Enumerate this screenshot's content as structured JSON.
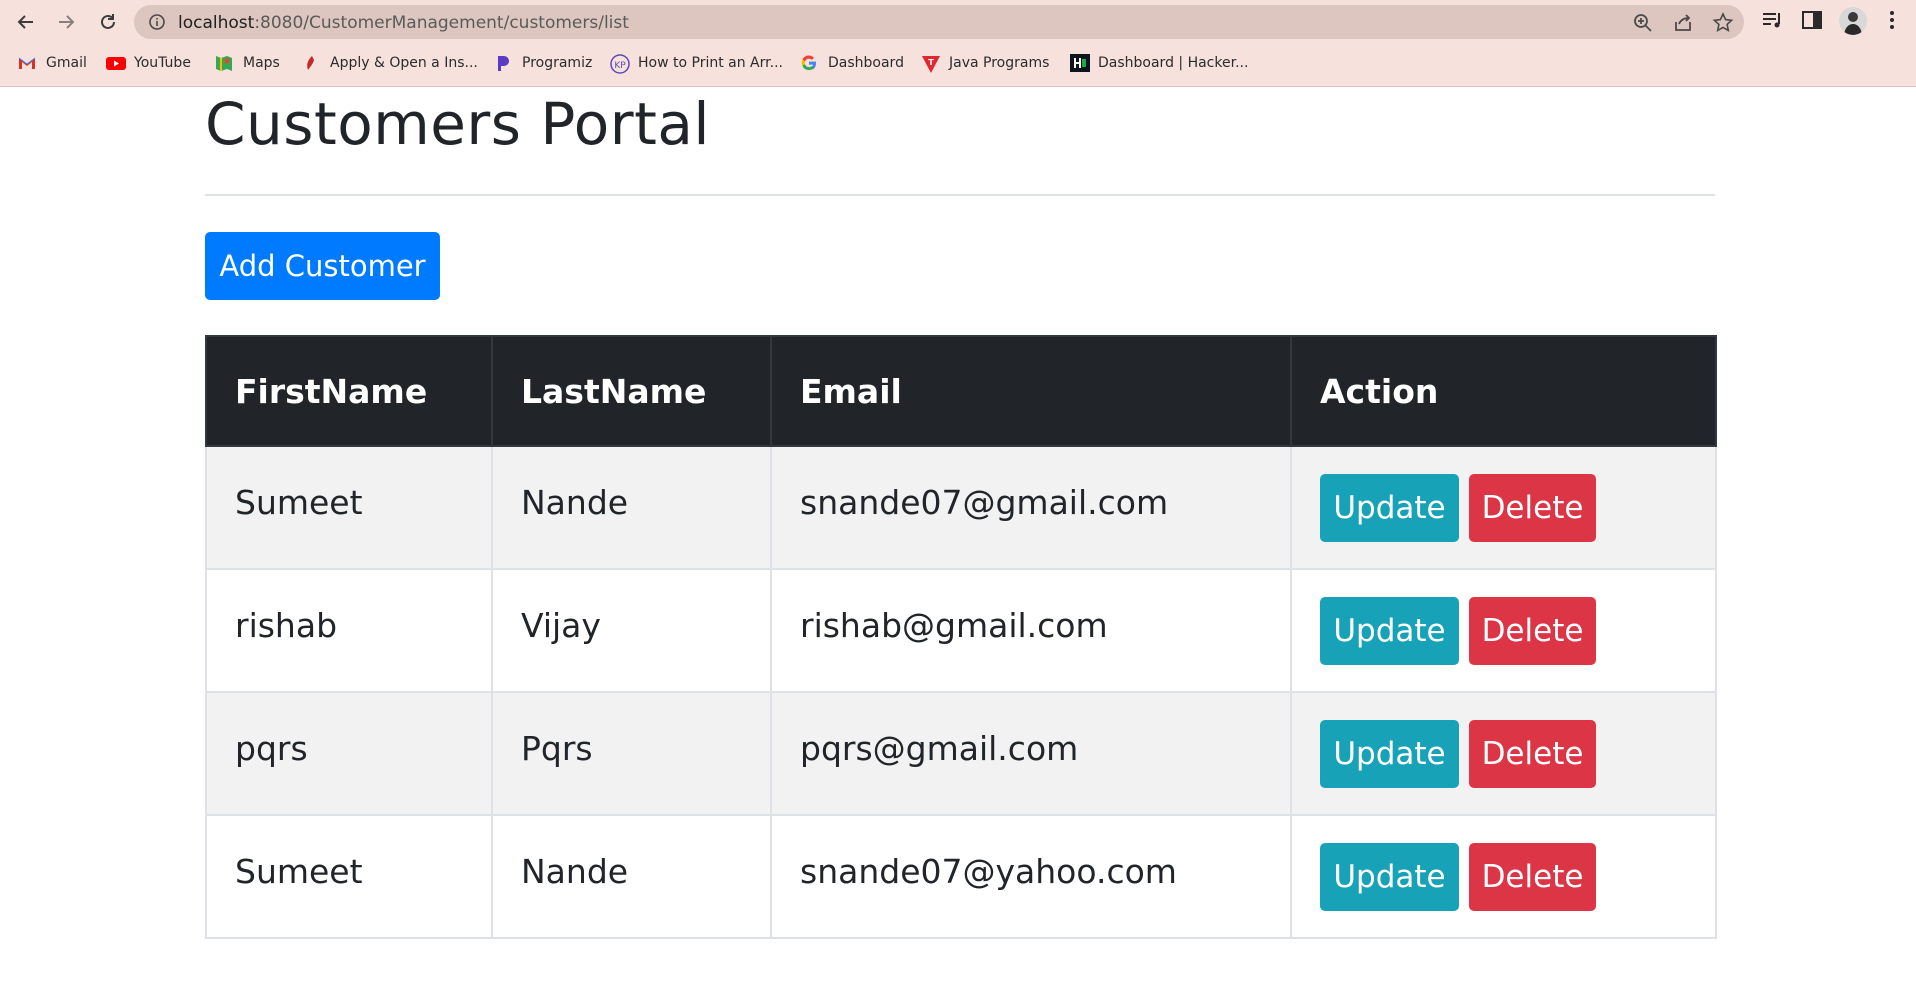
{
  "browser": {
    "url_host": "localhost",
    "url_rest": ":8080/CustomerManagement/customers/list",
    "bookmarks": [
      {
        "label": "Gmail",
        "icon": "gmail-icon"
      },
      {
        "label": "YouTube",
        "icon": "youtube-icon"
      },
      {
        "label": "Maps",
        "icon": "maps-icon"
      },
      {
        "label": "Apply & Open a Ins...",
        "icon": "apply-icon"
      },
      {
        "label": "Programiz",
        "icon": "programiz-icon"
      },
      {
        "label": "How to Print an Arr...",
        "icon": "kp-icon"
      },
      {
        "label": "Dashboard",
        "icon": "google-icon"
      },
      {
        "label": "Java Programs",
        "icon": "java-icon"
      },
      {
        "label": "Dashboard | Hacker...",
        "icon": "hackerrank-icon"
      }
    ]
  },
  "page": {
    "title": "Customers Portal",
    "add_button": "Add Customer"
  },
  "table": {
    "headers": [
      "FirstName",
      "LastName",
      "Email",
      "Action"
    ],
    "rows": [
      {
        "first": "Sumeet",
        "last": "Nande",
        "email": "snande07@gmail.com"
      },
      {
        "first": "rishab",
        "last": "Vijay",
        "email": "rishab@gmail.com"
      },
      {
        "first": "pqrs",
        "last": "Pqrs",
        "email": "pqrs@gmail.com"
      },
      {
        "first": "Sumeet",
        "last": "Nande",
        "email": "snande07@yahoo.com"
      }
    ],
    "update_label": "Update",
    "delete_label": "Delete"
  },
  "colors": {
    "primary": "#007bff",
    "info": "#17a2b8",
    "danger": "#dc3545",
    "header_dark": "#212529",
    "chrome": "#f6e1dc"
  }
}
